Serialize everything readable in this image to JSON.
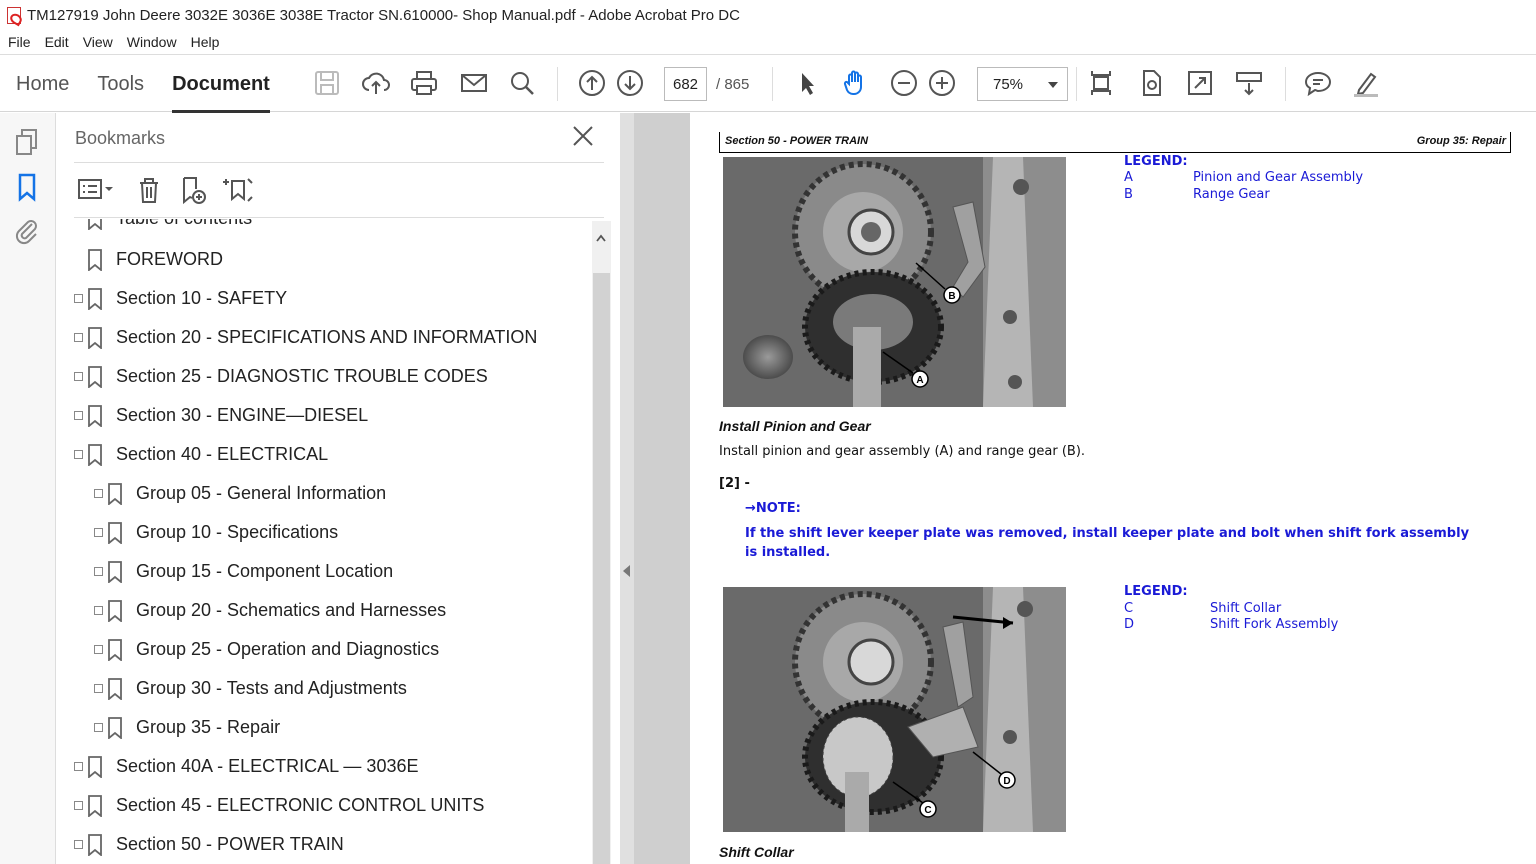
{
  "window": {
    "title": "TM127919 John Deere 3032E 3036E 3038E Tractor SN.610000- Shop Manual.pdf - Adobe Acrobat Pro DC"
  },
  "menu": [
    "File",
    "Edit",
    "View",
    "Window",
    "Help"
  ],
  "tabs": [
    {
      "label": "Home",
      "active": false
    },
    {
      "label": "Tools",
      "active": false
    },
    {
      "label": "Document",
      "active": true
    }
  ],
  "toolbar": {
    "page_current": "682",
    "page_total": "/ 865",
    "zoom": "75%",
    "icons": [
      "save-icon",
      "upload-icon",
      "print-icon",
      "email-icon",
      "search-icon",
      "page-up-icon",
      "page-down-icon",
      "select-arrow-icon",
      "hand-icon",
      "zoom-out-icon",
      "zoom-in-icon",
      "fit-page-icon",
      "rotate-icon",
      "full-screen-icon",
      "read-mode-icon",
      "comment-icon",
      "highlight-icon"
    ]
  },
  "bookmarks": {
    "title": "Bookmarks",
    "items": [
      {
        "label": "Table of contents",
        "level": 0,
        "expandable": false
      },
      {
        "label": "FOREWORD",
        "level": 0,
        "expandable": false
      },
      {
        "label": "Section 10 - SAFETY",
        "level": 0,
        "expandable": true
      },
      {
        "label": "Section 20 - SPECIFICATIONS AND INFORMATION",
        "level": 0,
        "expandable": true
      },
      {
        "label": "Section 25 - DIAGNOSTIC TROUBLE CODES",
        "level": 0,
        "expandable": true
      },
      {
        "label": "Section 30 - ENGINE—DIESEL",
        "level": 0,
        "expandable": true
      },
      {
        "label": "Section 40 - ELECTRICAL",
        "level": 0,
        "expandable": true
      },
      {
        "label": "Group 05 - General Information",
        "level": 1,
        "expandable": true
      },
      {
        "label": "Group 10 - Specifications",
        "level": 1,
        "expandable": true
      },
      {
        "label": "Group 15 - Component Location",
        "level": 1,
        "expandable": true
      },
      {
        "label": "Group 20 - Schematics and Harnesses",
        "level": 1,
        "expandable": true
      },
      {
        "label": "Group 25 - Operation and Diagnostics",
        "level": 1,
        "expandable": true
      },
      {
        "label": "Group 30 - Tests and Adjustments",
        "level": 1,
        "expandable": true
      },
      {
        "label": "Group 35 - Repair",
        "level": 1,
        "expandable": true
      },
      {
        "label": "Section 40A - ELECTRICAL — 3036E",
        "level": 0,
        "expandable": true
      },
      {
        "label": "Section 45 - ELECTRONIC CONTROL UNITS",
        "level": 0,
        "expandable": true
      },
      {
        "label": "Section 50 - POWER TRAIN",
        "level": 0,
        "expandable": true
      }
    ]
  },
  "document": {
    "header_left": "Section 50 - POWER TRAIN",
    "header_right": "Group 35: Repair",
    "legend1": {
      "title": "LEGEND:",
      "rows": [
        {
          "key": "A",
          "value": "Pinion and Gear Assembly"
        },
        {
          "key": "B",
          "value": "Range Gear"
        }
      ]
    },
    "photo1_labels": [
      "A",
      "B"
    ],
    "caption1": "Install Pinion and Gear",
    "text1": "Install pinion and gear assembly (A) and range gear (B).",
    "step": "[2] -",
    "note_title": "→NOTE:",
    "note_text": "If the shift lever keeper plate was removed, install keeper plate and bolt when shift fork assembly is installed.",
    "legend2": {
      "title": "LEGEND:",
      "rows": [
        {
          "key": "C",
          "value": "Shift Collar"
        },
        {
          "key": "D",
          "value": "Shift Fork Assembly"
        }
      ]
    },
    "photo2_labels": [
      "C",
      "D"
    ],
    "caption2": "Shift Collar"
  }
}
